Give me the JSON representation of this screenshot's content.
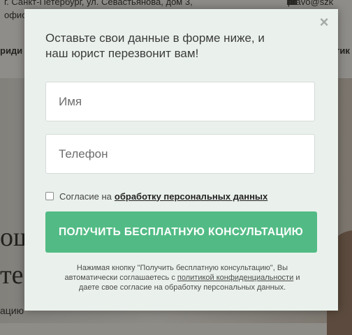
{
  "background": {
    "address_line1": "г. Санкт-Петербург, ул. Севастьянова, дом 3,",
    "address_line2": "офис",
    "email": "pravo@szk",
    "nav_left": "риди",
    "nav_right": "тик",
    "hero_line1": "ош",
    "hero_line2": "те",
    "hero_line3": "ацию"
  },
  "modal": {
    "close_label": "×",
    "title": "Оставьте свои данные в форме ниже, и наш юрист перезвонит вам!",
    "name_placeholder": "Имя",
    "phone_placeholder": "Телефон",
    "consent_label": "Согласие на",
    "consent_link": "обработку персональных данных",
    "submit_label": "ПОЛУЧИТЬ БЕСПЛАТНУЮ КОНСУЛЬТАЦИЮ",
    "legal_before": "Нажимая кнопку \"Получить бесплатную консультацию\", Вы автоматически соглашаетесь с",
    "legal_link": "политикой конфиденциальности",
    "legal_after": "и даете свое согласие на обработку персональных данных.",
    "accent_color": "#52bb85"
  }
}
